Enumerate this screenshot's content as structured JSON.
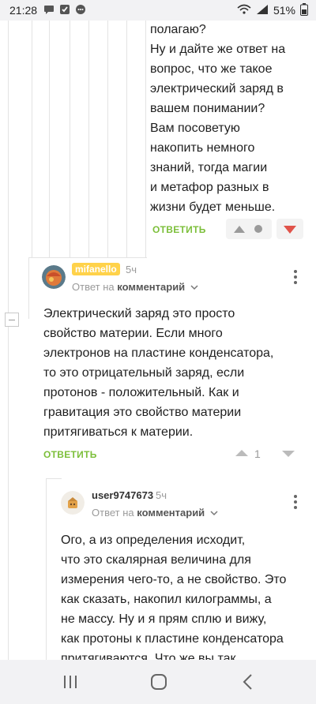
{
  "status_bar": {
    "time": "21:28",
    "battery": "51%"
  },
  "comments": [
    {
      "text_lines": [
        "полагаю?",
        "Ну и дайте же ответ на",
        "вопрос, что же такое",
        "электрический заряд в",
        "вашем понимании?",
        "Вам посоветую",
        "накопить немного",
        "знаний, тогда магии",
        "и метафор разных в",
        "жизни будет меньше."
      ],
      "reply_label": "ОТВЕТИТЬ"
    },
    {
      "username": "mifanello",
      "ago": "5ч",
      "reply_prefix": "Ответ на",
      "reply_target": "комментарий",
      "text_lines": [
        "Электрический заряд это просто",
        "свойство материи. Если много",
        "электронов на пластине конденсатора,",
        "то это отрицательный заряд, если",
        "протонов - положительный. Как и",
        "гравитация это свойство материи",
        "притягиваться к материи."
      ],
      "reply_label": "ОТВЕТИТЬ",
      "rating": "1"
    },
    {
      "username": "user9747673",
      "ago": "5ч",
      "reply_prefix": "Ответ на",
      "reply_target": "комментарий",
      "text_lines": [
        "Ого, а из определения исходит,",
        "что это скалярная величина для",
        "измерения чего-то, а не свойство. Это",
        "как сказать, накопил килограммы, а",
        "не массу. Ну и я прям сплю и вижу,",
        "как протоны к пластине конденсатора",
        "притягиваются. Что же вы так"
      ]
    }
  ],
  "colors": {
    "accent_green": "#7cbf3a",
    "downvote_red": "#e0534a",
    "badge_yellow": "#ffd24a"
  }
}
